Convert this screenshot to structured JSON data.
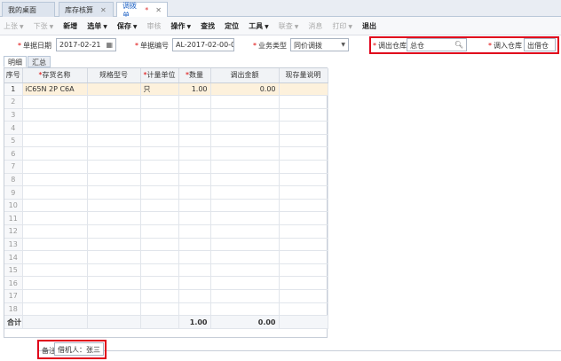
{
  "tabs": [
    {
      "label": "我的桌面",
      "closable": false,
      "active": false
    },
    {
      "label": "库存核算",
      "closable": true,
      "active": false
    },
    {
      "label": "调拨单",
      "closable": true,
      "active": true,
      "modified_mark": "*"
    }
  ],
  "toolbar": [
    {
      "label": "上张",
      "dropdown": true,
      "enabled": false
    },
    {
      "label": "下张",
      "dropdown": true,
      "enabled": false
    },
    {
      "label": "新增",
      "dropdown": false,
      "enabled": true
    },
    {
      "label": "选单",
      "dropdown": true,
      "enabled": true
    },
    {
      "label": "保存",
      "dropdown": true,
      "enabled": true
    },
    {
      "label": "审核",
      "dropdown": false,
      "enabled": false
    },
    {
      "label": "操作",
      "dropdown": true,
      "enabled": true
    },
    {
      "label": "查找",
      "dropdown": false,
      "enabled": true
    },
    {
      "label": "定位",
      "dropdown": false,
      "enabled": true
    },
    {
      "label": "工具",
      "dropdown": true,
      "enabled": true
    },
    {
      "label": "联查",
      "dropdown": true,
      "enabled": false
    },
    {
      "label": "消息",
      "dropdown": false,
      "enabled": false
    },
    {
      "label": "打印",
      "dropdown": true,
      "enabled": false
    },
    {
      "label": "退出",
      "dropdown": false,
      "enabled": true
    }
  ],
  "form": {
    "required_mark": "*",
    "doc_date_label": "单据日期",
    "doc_date_value": "2017-02-21",
    "doc_no_label": "单据编号",
    "doc_no_value": "AL-2017-02-00-0...",
    "biz_type_label": "业务类型",
    "biz_type_value": "同价调拨",
    "out_wh_label": "调出仓库",
    "out_wh_value": "总仓",
    "in_wh_label": "调入仓库",
    "in_wh_value": "出借仓"
  },
  "subtabs": [
    {
      "label": "明细",
      "active": true
    },
    {
      "label": "汇总",
      "active": false
    }
  ],
  "grid": {
    "columns": [
      {
        "label": "序号",
        "required": false
      },
      {
        "label": "存货名称",
        "required": true
      },
      {
        "label": "规格型号",
        "required": false
      },
      {
        "label": "计量单位",
        "required": true
      },
      {
        "label": "数量",
        "required": true
      },
      {
        "label": "调出金额",
        "required": false
      },
      {
        "label": "现存量说明",
        "required": false
      }
    ],
    "rows": [
      [
        "1",
        "iC65N 2P C6A",
        "",
        "只",
        "1.00",
        "0.00",
        ""
      ],
      [
        "2",
        "",
        "",
        "",
        "",
        "",
        ""
      ],
      [
        "3",
        "",
        "",
        "",
        "",
        "",
        ""
      ],
      [
        "4",
        "",
        "",
        "",
        "",
        "",
        ""
      ],
      [
        "5",
        "",
        "",
        "",
        "",
        "",
        ""
      ],
      [
        "6",
        "",
        "",
        "",
        "",
        "",
        ""
      ],
      [
        "7",
        "",
        "",
        "",
        "",
        "",
        ""
      ],
      [
        "8",
        "",
        "",
        "",
        "",
        "",
        ""
      ],
      [
        "9",
        "",
        "",
        "",
        "",
        "",
        ""
      ],
      [
        "10",
        "",
        "",
        "",
        "",
        "",
        ""
      ],
      [
        "11",
        "",
        "",
        "",
        "",
        "",
        ""
      ],
      [
        "12",
        "",
        "",
        "",
        "",
        "",
        ""
      ],
      [
        "13",
        "",
        "",
        "",
        "",
        "",
        ""
      ],
      [
        "14",
        "",
        "",
        "",
        "",
        "",
        ""
      ],
      [
        "15",
        "",
        "",
        "",
        "",
        "",
        ""
      ],
      [
        "16",
        "",
        "",
        "",
        "",
        "",
        ""
      ],
      [
        "17",
        "",
        "",
        "",
        "",
        "",
        ""
      ],
      [
        "18",
        "",
        "",
        "",
        "",
        "",
        ""
      ]
    ],
    "total": {
      "label": "合计",
      "quantity": "1.00",
      "amount": "0.00"
    }
  },
  "remark": {
    "label": "备注",
    "value": "借机人：张三"
  },
  "icons": {
    "calendar": "calendar-icon",
    "search": "search-icon",
    "dropdown": "chevron-down-icon"
  },
  "colors": {
    "highlight_border": "#e0001b",
    "active_tab_text": "#1f63c6",
    "selected_row": "#fdf1dc"
  }
}
